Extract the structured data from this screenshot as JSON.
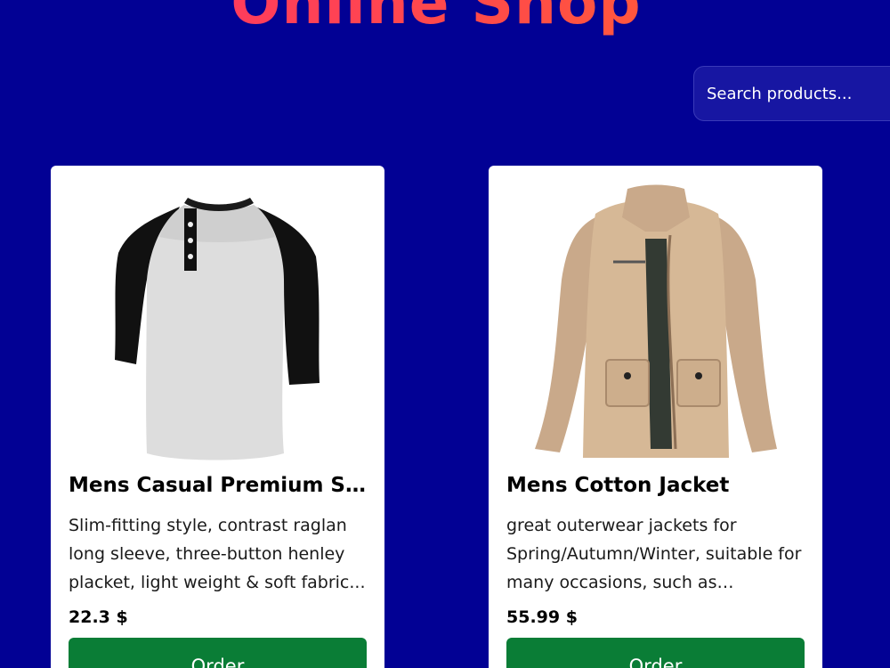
{
  "header": {
    "title": "Online Shop"
  },
  "search": {
    "placeholder": "Search products..."
  },
  "products": [
    {
      "name": "Mens Casual Premium Sli...",
      "description": "Slim-fitting style, contrast raglan long sleeve, three-button henley placket, light weight & soft fabric...",
      "price": "22.3 $",
      "order_label": "Order",
      "image_icon": "raglan-henley-shirt"
    },
    {
      "name": "Mens Cotton Jacket",
      "description": "great outerwear jackets for Spring/Autumn/Winter, suitable for many occasions, such as working,...",
      "price": "55.99 $",
      "order_label": "Order",
      "image_icon": "khaki-cotton-jacket"
    }
  ],
  "colors": {
    "background": "#020194",
    "title_gradient_start": "#ff2f6d",
    "title_gradient_end": "#ff6a2e",
    "order_button": "#0a7d36",
    "card": "#ffffff"
  }
}
